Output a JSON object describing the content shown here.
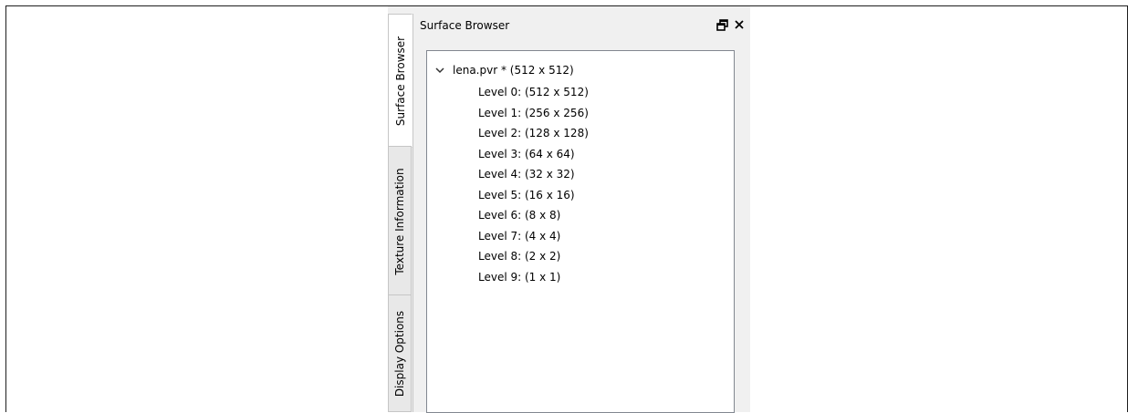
{
  "tabs": [
    {
      "label": "Surface Browser",
      "active": true
    },
    {
      "label": "Texture Information",
      "active": false
    },
    {
      "label": "Display Options",
      "active": false
    }
  ],
  "panel": {
    "title": "Surface Browser",
    "float_icon": "float-window-icon",
    "close_icon": "close-icon"
  },
  "tree": {
    "root_label": "lena.pvr * (512 x 512)",
    "expanded": true,
    "levels": [
      "Level 0: (512 x 512)",
      "Level 1: (256 x 256)",
      "Level 2: (128 x 128)",
      "Level 3: (64 x 64)",
      "Level 4: (32 x 32)",
      "Level 5: (16 x 16)",
      "Level 6: (8 x 8)",
      "Level 7: (4 x 4)",
      "Level 8: (2 x 2)",
      "Level 9: (1 x 1)"
    ]
  },
  "colors": {
    "dock_background": "#f0f0f0",
    "tree_border": "#828790",
    "tab_border": "#c6c6c6"
  }
}
